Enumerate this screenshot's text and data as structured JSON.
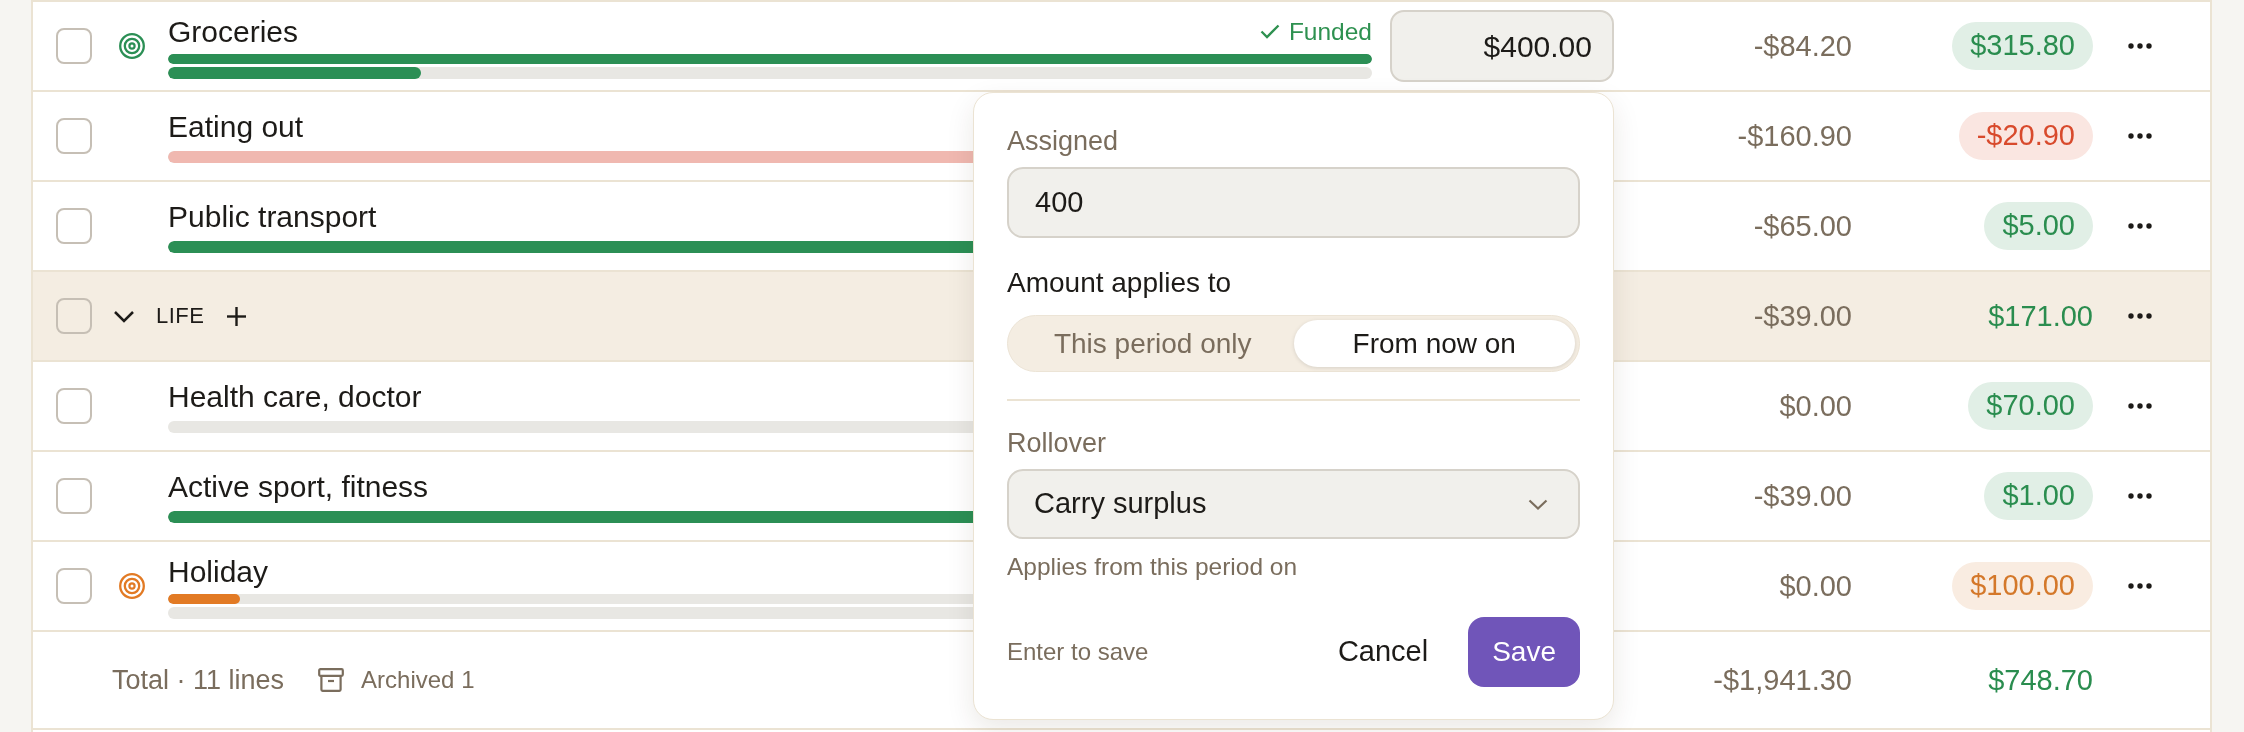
{
  "lines": [
    {
      "kind": "category",
      "checked": false,
      "name": "Groceries",
      "goal": {
        "color": "#2b8f55",
        "level": 1
      },
      "status_label": "Funded",
      "spent": {
        "overspent": false,
        "level": 0.21
      },
      "assigned": "$400.00",
      "activity": "-$84.20",
      "available": {
        "text": "$315.80",
        "color": "#2a8d4f"
      }
    },
    {
      "kind": "category",
      "checked": false,
      "name": "Eating out",
      "spent": {
        "overspent": true,
        "level": 1
      },
      "activity": "-$160.90",
      "available": {
        "text": "-$20.90",
        "color": "#d84a2c"
      }
    },
    {
      "kind": "category",
      "checked": false,
      "name": "Public transport",
      "spent": {
        "overspent": false,
        "level": 0.93
      },
      "activity": "-$65.00",
      "available": {
        "text": "$5.00",
        "color": "#2a8d4f"
      }
    },
    {
      "kind": "group",
      "checked": false,
      "expanded": true,
      "name": "LIFE",
      "activity": "-$39.00",
      "available": {
        "text": "$171.00",
        "color": "#2a8d4f"
      }
    },
    {
      "kind": "category",
      "checked": false,
      "name": "Health care, doctor",
      "spent": {
        "level": 0
      },
      "activity": "$0.00",
      "available": {
        "text": "$70.00",
        "color": "#2a8d4f"
      }
    },
    {
      "kind": "category",
      "checked": false,
      "name": "Active sport, fitness",
      "spent": {
        "overspent": false,
        "level": 0.975
      },
      "activity": "-$39.00",
      "available": {
        "text": "$1.00",
        "color": "#2a8d4f"
      }
    },
    {
      "kind": "category",
      "checked": false,
      "name": "Holiday",
      "goal": {
        "color": "#e27a24",
        "level": 0.06
      },
      "spent": {
        "level": 0
      },
      "activity": "$0.00",
      "available": {
        "text": "$100.00",
        "color": "#d4782a"
      }
    }
  ],
  "total": {
    "label": "Total · 11 lines",
    "archived": "Archived 1",
    "activity": "-$1,941.30",
    "available": {
      "text": "$748.70",
      "color": "#2a8d4f"
    }
  },
  "popover": {
    "assigned_label": "Assigned",
    "assigned_value": "400",
    "scope_label": "Amount applies to",
    "scope_options": [
      {
        "label": "This period only",
        "selected": false
      },
      {
        "label": "From now on",
        "selected": true
      }
    ],
    "rollover_label": "Rollover",
    "rollover_value": "Carry surplus",
    "rollover_hint": "Applies from this period on",
    "shortcut_hint": "Enter to save",
    "buttons": [
      {
        "kind": "cancel",
        "label": "Cancel"
      },
      {
        "kind": "save",
        "label": "Save"
      }
    ]
  }
}
